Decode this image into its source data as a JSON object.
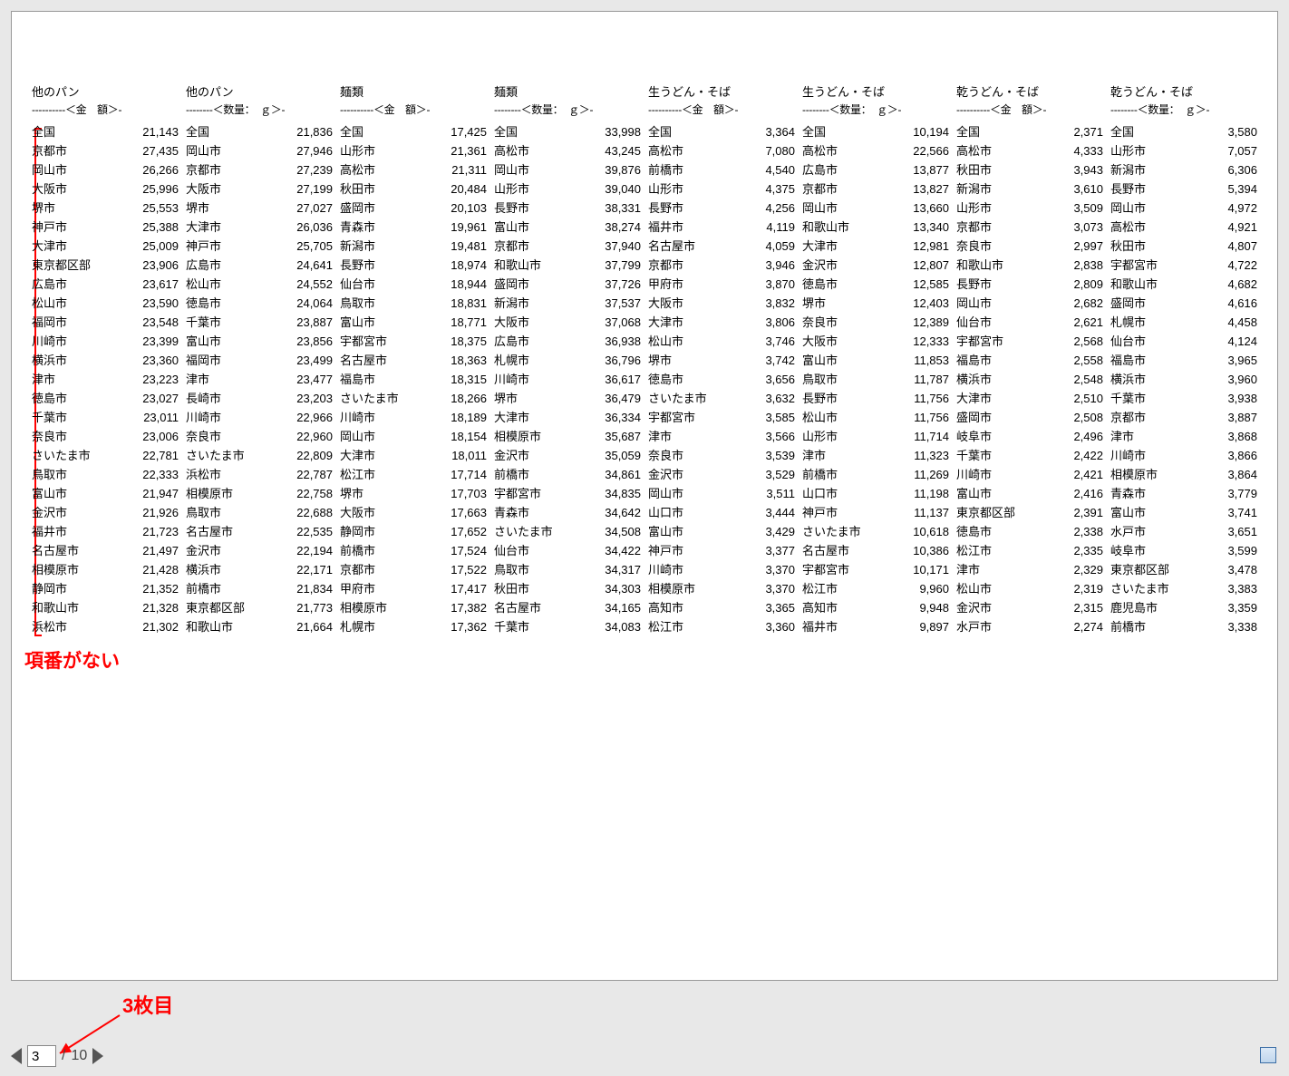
{
  "pager": {
    "current": "3",
    "sep": "/",
    "total": "10"
  },
  "annotations": {
    "missing_item_number": "項番がない",
    "third_page": "3枚目"
  },
  "columns": [
    {
      "title": "他のパン",
      "subtitle": "----------＜金　額＞-",
      "rows": [
        [
          "全国",
          "21,143"
        ],
        [
          "京都市",
          "27,435"
        ],
        [
          "岡山市",
          "26,266"
        ],
        [
          "大阪市",
          "25,996"
        ],
        [
          "堺市",
          "25,553"
        ],
        [
          "神戸市",
          "25,388"
        ],
        [
          "大津市",
          "25,009"
        ],
        [
          "東京都区部",
          "23,906"
        ],
        [
          "広島市",
          "23,617"
        ],
        [
          "松山市",
          "23,590"
        ],
        [
          "福岡市",
          "23,548"
        ],
        [
          "川崎市",
          "23,399"
        ],
        [
          "横浜市",
          "23,360"
        ],
        [
          "津市",
          "23,223"
        ],
        [
          "徳島市",
          "23,027"
        ],
        [
          "千葉市",
          "23,011"
        ],
        [
          "奈良市",
          "23,006"
        ],
        [
          "さいたま市",
          "22,781"
        ],
        [
          "鳥取市",
          "22,333"
        ],
        [
          "富山市",
          "21,947"
        ],
        [
          "金沢市",
          "21,926"
        ],
        [
          "福井市",
          "21,723"
        ],
        [
          "名古屋市",
          "21,497"
        ],
        [
          "相模原市",
          "21,428"
        ],
        [
          "静岡市",
          "21,352"
        ],
        [
          "和歌山市",
          "21,328"
        ],
        [
          "浜松市",
          "21,302"
        ]
      ]
    },
    {
      "title": "他のパン",
      "subtitle": "--------＜数量：　ｇ＞-",
      "rows": [
        [
          "全国",
          "21,836"
        ],
        [
          "岡山市",
          "27,946"
        ],
        [
          "京都市",
          "27,239"
        ],
        [
          "大阪市",
          "27,199"
        ],
        [
          "堺市",
          "27,027"
        ],
        [
          "大津市",
          "26,036"
        ],
        [
          "神戸市",
          "25,705"
        ],
        [
          "広島市",
          "24,641"
        ],
        [
          "松山市",
          "24,552"
        ],
        [
          "徳島市",
          "24,064"
        ],
        [
          "千葉市",
          "23,887"
        ],
        [
          "富山市",
          "23,856"
        ],
        [
          "福岡市",
          "23,499"
        ],
        [
          "津市",
          "23,477"
        ],
        [
          "長崎市",
          "23,203"
        ],
        [
          "川崎市",
          "22,966"
        ],
        [
          "奈良市",
          "22,960"
        ],
        [
          "さいたま市",
          "22,809"
        ],
        [
          "浜松市",
          "22,787"
        ],
        [
          "相模原市",
          "22,758"
        ],
        [
          "鳥取市",
          "22,688"
        ],
        [
          "名古屋市",
          "22,535"
        ],
        [
          "金沢市",
          "22,194"
        ],
        [
          "横浜市",
          "22,171"
        ],
        [
          "前橋市",
          "21,834"
        ],
        [
          "東京都区部",
          "21,773"
        ],
        [
          "和歌山市",
          "21,664"
        ]
      ]
    },
    {
      "title": "麺類",
      "subtitle": "----------＜金　額＞-",
      "rows": [
        [
          "全国",
          "17,425"
        ],
        [
          "山形市",
          "21,361"
        ],
        [
          "高松市",
          "21,311"
        ],
        [
          "秋田市",
          "20,484"
        ],
        [
          "盛岡市",
          "20,103"
        ],
        [
          "青森市",
          "19,961"
        ],
        [
          "新潟市",
          "19,481"
        ],
        [
          "長野市",
          "18,974"
        ],
        [
          "仙台市",
          "18,944"
        ],
        [
          "鳥取市",
          "18,831"
        ],
        [
          "富山市",
          "18,771"
        ],
        [
          "宇都宮市",
          "18,375"
        ],
        [
          "名古屋市",
          "18,363"
        ],
        [
          "福島市",
          "18,315"
        ],
        [
          "さいたま市",
          "18,266"
        ],
        [
          "川崎市",
          "18,189"
        ],
        [
          "岡山市",
          "18,154"
        ],
        [
          "大津市",
          "18,011"
        ],
        [
          "松江市",
          "17,714"
        ],
        [
          "堺市",
          "17,703"
        ],
        [
          "大阪市",
          "17,663"
        ],
        [
          "静岡市",
          "17,652"
        ],
        [
          "前橋市",
          "17,524"
        ],
        [
          "京都市",
          "17,522"
        ],
        [
          "甲府市",
          "17,417"
        ],
        [
          "相模原市",
          "17,382"
        ],
        [
          "札幌市",
          "17,362"
        ]
      ]
    },
    {
      "title": "麺類",
      "subtitle": "--------＜数量：　ｇ＞-",
      "rows": [
        [
          "全国",
          "33,998"
        ],
        [
          "高松市",
          "43,245"
        ],
        [
          "岡山市",
          "39,876"
        ],
        [
          "山形市",
          "39,040"
        ],
        [
          "長野市",
          "38,331"
        ],
        [
          "富山市",
          "38,274"
        ],
        [
          "京都市",
          "37,940"
        ],
        [
          "和歌山市",
          "37,799"
        ],
        [
          "盛岡市",
          "37,726"
        ],
        [
          "新潟市",
          "37,537"
        ],
        [
          "大阪市",
          "37,068"
        ],
        [
          "広島市",
          "36,938"
        ],
        [
          "札幌市",
          "36,796"
        ],
        [
          "川崎市",
          "36,617"
        ],
        [
          "堺市",
          "36,479"
        ],
        [
          "大津市",
          "36,334"
        ],
        [
          "相模原市",
          "35,687"
        ],
        [
          "金沢市",
          "35,059"
        ],
        [
          "前橋市",
          "34,861"
        ],
        [
          "宇都宮市",
          "34,835"
        ],
        [
          "青森市",
          "34,642"
        ],
        [
          "さいたま市",
          "34,508"
        ],
        [
          "仙台市",
          "34,422"
        ],
        [
          "鳥取市",
          "34,317"
        ],
        [
          "秋田市",
          "34,303"
        ],
        [
          "名古屋市",
          "34,165"
        ],
        [
          "千葉市",
          "34,083"
        ]
      ]
    },
    {
      "title": "生うどん・そば",
      "subtitle": "----------＜金　額＞-",
      "rows": [
        [
          "全国",
          "3,364"
        ],
        [
          "高松市",
          "7,080"
        ],
        [
          "前橋市",
          "4,540"
        ],
        [
          "山形市",
          "4,375"
        ],
        [
          "長野市",
          "4,256"
        ],
        [
          "福井市",
          "4,119"
        ],
        [
          "名古屋市",
          "4,059"
        ],
        [
          "京都市",
          "3,946"
        ],
        [
          "甲府市",
          "3,870"
        ],
        [
          "大阪市",
          "3,832"
        ],
        [
          "大津市",
          "3,806"
        ],
        [
          "松山市",
          "3,746"
        ],
        [
          "堺市",
          "3,742"
        ],
        [
          "徳島市",
          "3,656"
        ],
        [
          "さいたま市",
          "3,632"
        ],
        [
          "宇都宮市",
          "3,585"
        ],
        [
          "津市",
          "3,566"
        ],
        [
          "奈良市",
          "3,539"
        ],
        [
          "金沢市",
          "3,529"
        ],
        [
          "岡山市",
          "3,511"
        ],
        [
          "山口市",
          "3,444"
        ],
        [
          "富山市",
          "3,429"
        ],
        [
          "神戸市",
          "3,377"
        ],
        [
          "川崎市",
          "3,370"
        ],
        [
          "相模原市",
          "3,370"
        ],
        [
          "高知市",
          "3,365"
        ],
        [
          "松江市",
          "3,360"
        ]
      ]
    },
    {
      "title": "生うどん・そば",
      "subtitle": "--------＜数量：　ｇ＞-",
      "rows": [
        [
          "全国",
          "10,194"
        ],
        [
          "高松市",
          "22,566"
        ],
        [
          "広島市",
          "13,877"
        ],
        [
          "京都市",
          "13,827"
        ],
        [
          "岡山市",
          "13,660"
        ],
        [
          "和歌山市",
          "13,340"
        ],
        [
          "大津市",
          "12,981"
        ],
        [
          "金沢市",
          "12,807"
        ],
        [
          "徳島市",
          "12,585"
        ],
        [
          "堺市",
          "12,403"
        ],
        [
          "奈良市",
          "12,389"
        ],
        [
          "大阪市",
          "12,333"
        ],
        [
          "富山市",
          "11,853"
        ],
        [
          "鳥取市",
          "11,787"
        ],
        [
          "長野市",
          "11,756"
        ],
        [
          "松山市",
          "11,756"
        ],
        [
          "山形市",
          "11,714"
        ],
        [
          "津市",
          "11,323"
        ],
        [
          "前橋市",
          "11,269"
        ],
        [
          "山口市",
          "11,198"
        ],
        [
          "神戸市",
          "11,137"
        ],
        [
          "さいたま市",
          "10,618"
        ],
        [
          "名古屋市",
          "10,386"
        ],
        [
          "宇都宮市",
          "10,171"
        ],
        [
          "松江市",
          "9,960"
        ],
        [
          "高知市",
          "9,948"
        ],
        [
          "福井市",
          "9,897"
        ]
      ]
    },
    {
      "title": "乾うどん・そば",
      "subtitle": "----------＜金　額＞-",
      "rows": [
        [
          "全国",
          "2,371"
        ],
        [
          "高松市",
          "4,333"
        ],
        [
          "秋田市",
          "3,943"
        ],
        [
          "新潟市",
          "3,610"
        ],
        [
          "山形市",
          "3,509"
        ],
        [
          "京都市",
          "3,073"
        ],
        [
          "奈良市",
          "2,997"
        ],
        [
          "和歌山市",
          "2,838"
        ],
        [
          "長野市",
          "2,809"
        ],
        [
          "岡山市",
          "2,682"
        ],
        [
          "仙台市",
          "2,621"
        ],
        [
          "宇都宮市",
          "2,568"
        ],
        [
          "福島市",
          "2,558"
        ],
        [
          "横浜市",
          "2,548"
        ],
        [
          "大津市",
          "2,510"
        ],
        [
          "盛岡市",
          "2,508"
        ],
        [
          "岐阜市",
          "2,496"
        ],
        [
          "千葉市",
          "2,422"
        ],
        [
          "川崎市",
          "2,421"
        ],
        [
          "富山市",
          "2,416"
        ],
        [
          "東京都区部",
          "2,391"
        ],
        [
          "徳島市",
          "2,338"
        ],
        [
          "松江市",
          "2,335"
        ],
        [
          "津市",
          "2,329"
        ],
        [
          "松山市",
          "2,319"
        ],
        [
          "金沢市",
          "2,315"
        ],
        [
          "水戸市",
          "2,274"
        ]
      ]
    },
    {
      "title": "乾うどん・そば",
      "subtitle": "--------＜数量：　ｇ＞-",
      "rows": [
        [
          "全国",
          "3,580"
        ],
        [
          "山形市",
          "7,057"
        ],
        [
          "新潟市",
          "6,306"
        ],
        [
          "長野市",
          "5,394"
        ],
        [
          "岡山市",
          "4,972"
        ],
        [
          "高松市",
          "4,921"
        ],
        [
          "秋田市",
          "4,807"
        ],
        [
          "宇都宮市",
          "4,722"
        ],
        [
          "和歌山市",
          "4,682"
        ],
        [
          "盛岡市",
          "4,616"
        ],
        [
          "札幌市",
          "4,458"
        ],
        [
          "仙台市",
          "4,124"
        ],
        [
          "福島市",
          "3,965"
        ],
        [
          "横浜市",
          "3,960"
        ],
        [
          "千葉市",
          "3,938"
        ],
        [
          "京都市",
          "3,887"
        ],
        [
          "津市",
          "3,868"
        ],
        [
          "川崎市",
          "3,866"
        ],
        [
          "相模原市",
          "3,864"
        ],
        [
          "青森市",
          "3,779"
        ],
        [
          "富山市",
          "3,741"
        ],
        [
          "水戸市",
          "3,651"
        ],
        [
          "岐阜市",
          "3,599"
        ],
        [
          "東京都区部",
          "3,478"
        ],
        [
          "さいたま市",
          "3,383"
        ],
        [
          "鹿児島市",
          "3,359"
        ],
        [
          "前橋市",
          "3,338"
        ]
      ]
    }
  ]
}
